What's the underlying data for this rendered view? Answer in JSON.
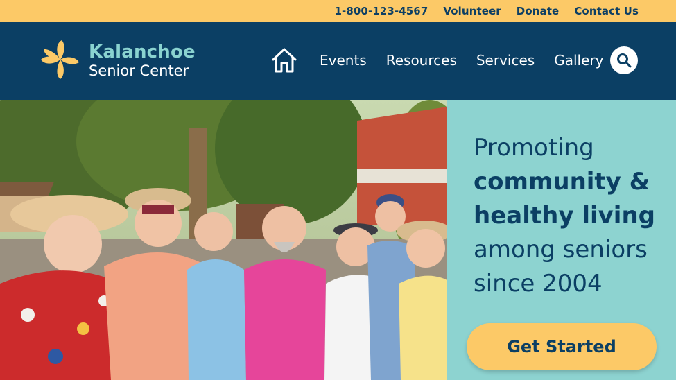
{
  "topbar": {
    "phone": "1-800-123-4567",
    "volunteer": "Volunteer",
    "donate": "Donate",
    "contact": "Contact Us"
  },
  "brand": {
    "name": "Kalanchoe",
    "subtitle": "Senior Center",
    "logo_icon": "flower-icon"
  },
  "nav": {
    "home_icon": "home-icon",
    "items": [
      "Events",
      "Resources",
      "Services",
      "Gallery"
    ],
    "search_icon": "search-icon"
  },
  "hero": {
    "headline": {
      "line1": "Promoting",
      "line2": "community &",
      "line3": "healthy living",
      "line4": "among seniors",
      "line5": "since 2004"
    },
    "cta_label": "Get Started",
    "photo_description": ""
  },
  "colors": {
    "topbar": "#fcc967",
    "navbar": "#0b3f64",
    "brand_accent": "#8ad3d0",
    "panel": "#8dd3d0",
    "cta": "#fcc967",
    "text_dark": "#0b3f64"
  }
}
